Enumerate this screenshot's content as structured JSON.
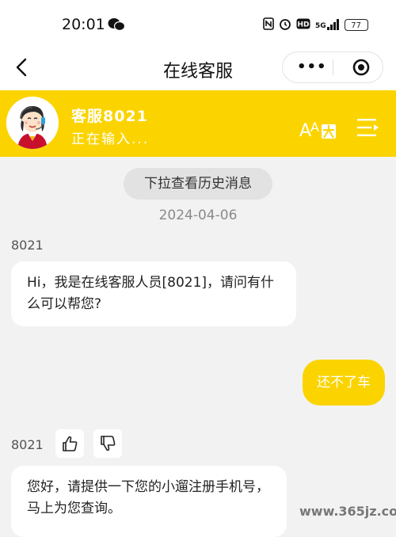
{
  "status_bar": {
    "time": "20:01",
    "network": "5G",
    "battery": "77"
  },
  "nav": {
    "title": "在线客服"
  },
  "agent": {
    "name": "客服8021",
    "status": "正在输入..."
  },
  "chat": {
    "history_label": "下拉查看历史消息",
    "date": "2024-04-06",
    "messages": [
      {
        "sender": "8021",
        "side": "left",
        "text": "Hi，我是在线客服人员[8021]，请问有什么可以帮您?"
      },
      {
        "sender": "",
        "side": "right",
        "text": "还不了车"
      },
      {
        "sender": "8021",
        "side": "left",
        "text": "您好，请提供一下您的小遛注册手机号，马上为您查询。"
      }
    ]
  },
  "watermark": "www.365jz.com",
  "colors": {
    "brand_yellow": "#fbd400",
    "background": "#f2f2f2"
  }
}
